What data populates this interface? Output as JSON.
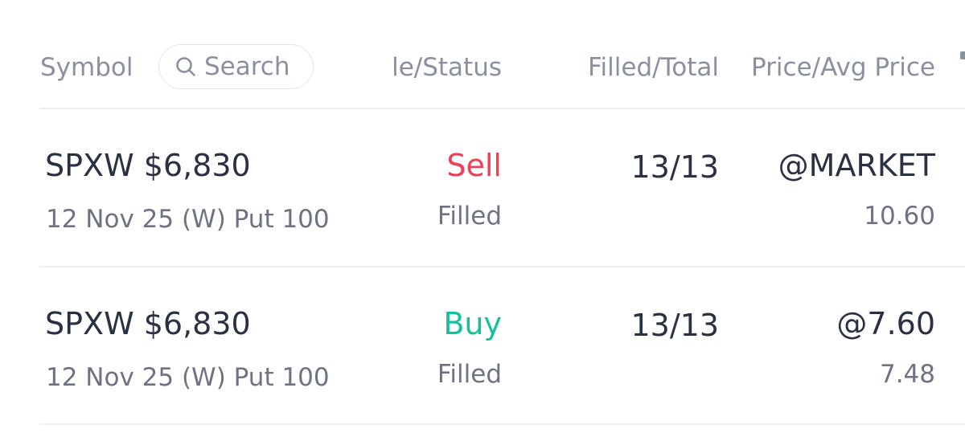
{
  "header": {
    "symbol_label": "Symbol",
    "search_placeholder": "Search",
    "side_status_label": "le/Status",
    "filled_total_label": "Filled/Total",
    "price_label": "Price/Avg Price"
  },
  "orders": [
    {
      "symbol": "SPXW $6,830",
      "contract": "12 Nov 25 (W) Put 100",
      "side": "Sell",
      "status": "Filled",
      "filled_total": "13/13",
      "price": "@MARKET",
      "avg_price": "10.60"
    },
    {
      "symbol": "SPXW $6,830",
      "contract": "12 Nov 25 (W) Put 100",
      "side": "Buy",
      "status": "Filled",
      "filled_total": "13/13",
      "price": "@7.60",
      "avg_price": "7.48"
    }
  ],
  "colors": {
    "sell": "#ef3f54",
    "buy": "#14c29a",
    "primary_text": "#2a3142",
    "secondary_text": "#6d7382",
    "header_text": "#8a909e",
    "divider": "#eceef1"
  },
  "icons": {
    "search": "search-icon"
  }
}
